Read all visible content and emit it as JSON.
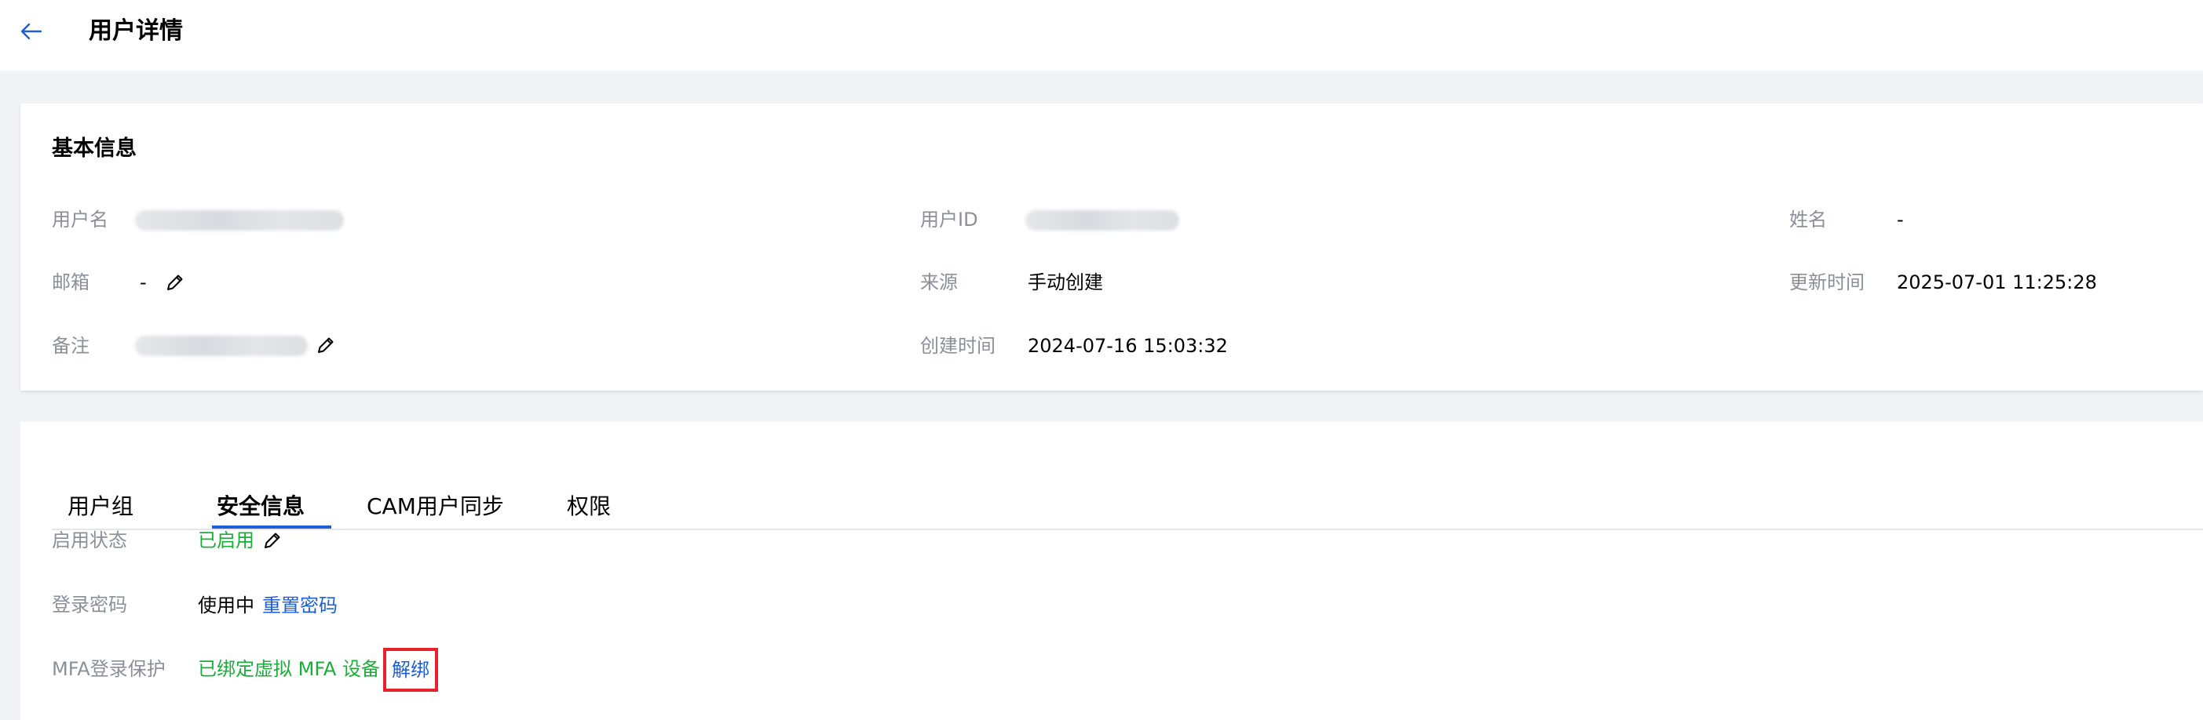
{
  "header": {
    "title": "用户详情",
    "back_icon": "arrow-left-icon"
  },
  "basic_info": {
    "title": "基本信息",
    "username_label": "用户名",
    "email_label": "邮箱",
    "email_value": "-",
    "note_label": "备注",
    "user_id_label": "用户ID",
    "source_label": "来源",
    "source_value": "手动创建",
    "created_label": "创建时间",
    "created_value": "2024-07-16 15:03:32",
    "name_label": "姓名",
    "name_value": "-",
    "updated_label": "更新时间",
    "updated_value": "2025-07-01 11:25:28",
    "edit_icon": "pencil-icon"
  },
  "tabs": [
    {
      "label": "用户组"
    },
    {
      "label": "安全信息"
    },
    {
      "label": "CAM用户同步"
    },
    {
      "label": "权限"
    }
  ],
  "security": {
    "status_label": "启用状态",
    "status_value": "已启用",
    "password_label": "登录密码",
    "password_value": "使用中",
    "reset_password": "重置密码",
    "mfa_label": "MFA登录保护",
    "mfa_value": "已绑定虚拟 MFA 设备",
    "unbind": "解绑"
  },
  "colors": {
    "accent": "#1f5fd6",
    "success": "#1aae39",
    "highlight_border": "#e8222d"
  }
}
